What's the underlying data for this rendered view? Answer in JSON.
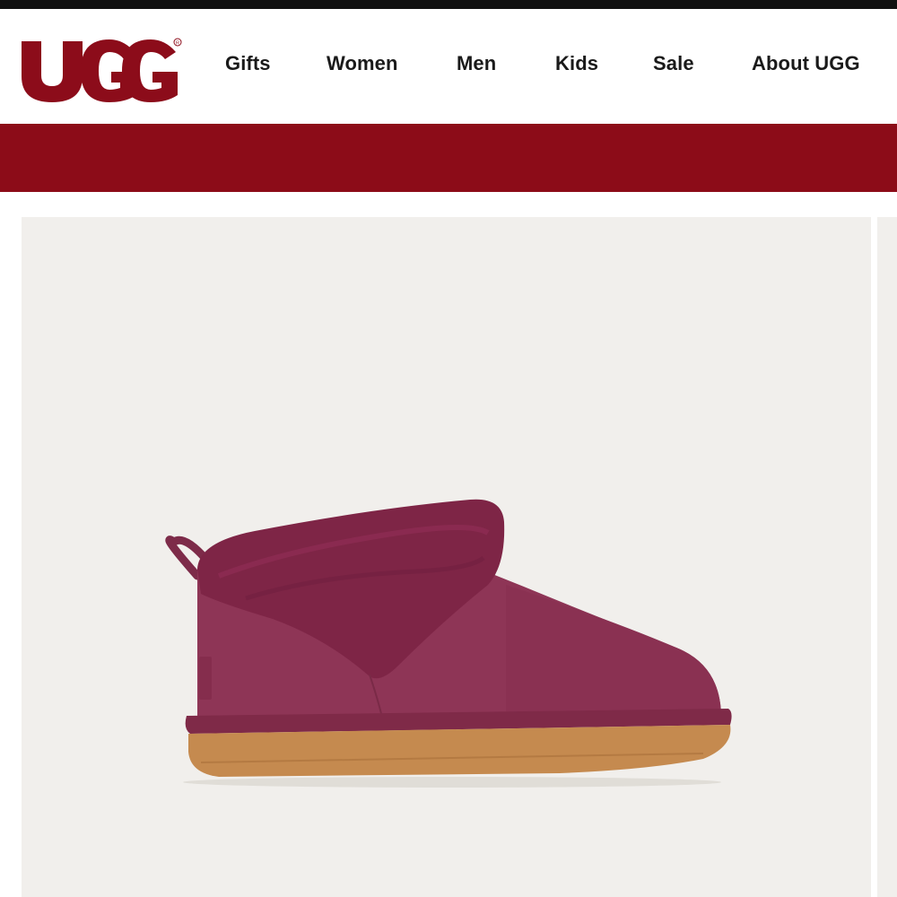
{
  "colors": {
    "brand": "#8c0c1a",
    "banner": "#8c0c18",
    "top_bar": "#111111",
    "nav_text": "#1a1a1a",
    "card_background": "#f1efec",
    "boot_body": "#8e3556",
    "boot_sole": "#c58a4f"
  },
  "header": {
    "logo_text": "UGG",
    "nav": [
      {
        "label": "Gifts"
      },
      {
        "label": "Women"
      },
      {
        "label": "Men"
      },
      {
        "label": "Kids"
      },
      {
        "label": "Sale"
      },
      {
        "label": "About UGG"
      }
    ]
  },
  "promo_banner": {},
  "product": {
    "image_icon": "boot-image"
  }
}
